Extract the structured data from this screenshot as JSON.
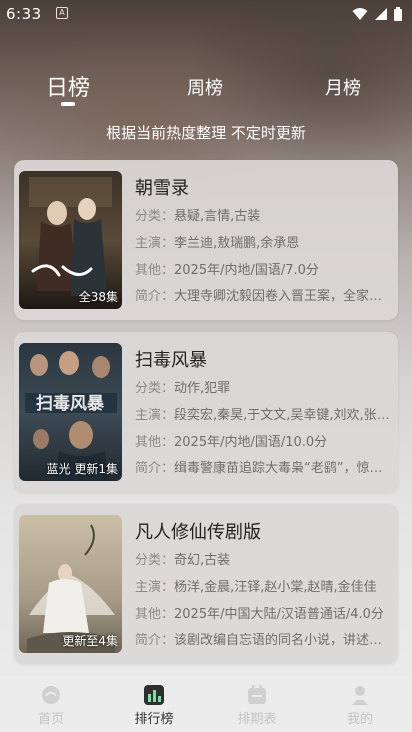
{
  "status_bar": {
    "time": "6:33",
    "notif": "A"
  },
  "tabs": [
    {
      "label": "日榜",
      "active": true
    },
    {
      "label": "周榜",
      "active": false
    },
    {
      "label": "月榜",
      "active": false
    }
  ],
  "subtitle": "根据当前热度整理 不定时更新",
  "items": [
    {
      "title": "朝雪录",
      "badge": "全38集",
      "genre_label": "分类：",
      "genre": "悬疑,言情,古装",
      "cast_label": "主演：",
      "cast": "李兰迪,敖瑞鹏,余承恩",
      "other_label": "其他：",
      "other": "2025年/内地/国语/7.0分",
      "synopsis_label": "简介：",
      "synopsis": "大理寺卿沈毅因卷入晋王案，全家被害"
    },
    {
      "title": "扫毒风暴",
      "badge": "蓝光 更新1集",
      "genre_label": "分类：",
      "genre": "动作,犯罪",
      "cast_label": "主演：",
      "cast": "段奕宏,秦昊,于文文,吴幸键,刘欢,张颂文",
      "other_label": "其他：",
      "other": "2025年/内地/国语/10.0分",
      "synopsis_label": "简介：",
      "synopsis": "缉毒警康苗追踪大毒枭“老鹞”，惊心动魄"
    },
    {
      "title": "凡人修仙传剧版",
      "badge": "更新至4集",
      "genre_label": "分类：",
      "genre": "奇幻,古装",
      "cast_label": "主演：",
      "cast": "杨洋,金晨,汪铎,赵小棠,赵晴,金佳佳",
      "other_label": "其他：",
      "other": "2025年/中国大陆/汉语普通话/4.0分",
      "synopsis_label": "简介：",
      "synopsis": "该剧改编自忘语的同名小说，讲述了韩立"
    }
  ],
  "nav": [
    {
      "label": "首页",
      "icon": "home-icon",
      "active": false
    },
    {
      "label": "排行榜",
      "icon": "ranking-icon",
      "active": true
    },
    {
      "label": "排期表",
      "icon": "calendar-icon",
      "active": false
    },
    {
      "label": "我的",
      "icon": "profile-icon",
      "active": false
    }
  ],
  "colors": {
    "active_text": "#333333",
    "inactive_text": "#c4c4c4",
    "card_bg": "#dad8d7"
  }
}
